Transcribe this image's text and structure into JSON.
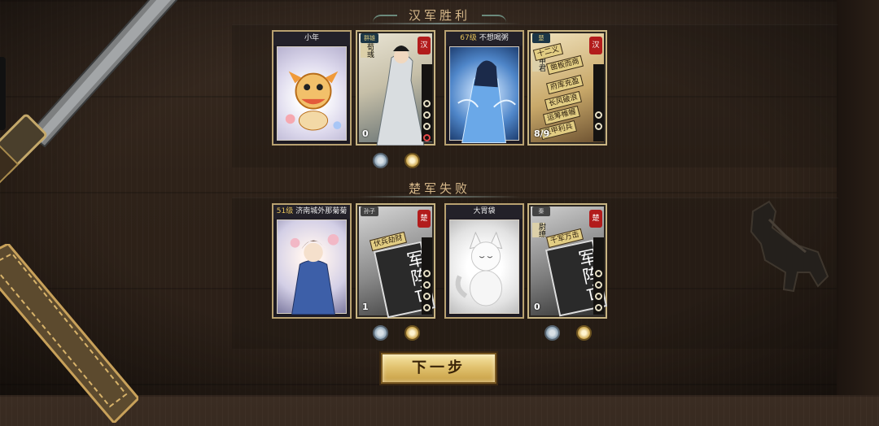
{
  "victory_title": "汉军胜利",
  "defeat_title": "楚军失败",
  "next_button_label": "下一步",
  "winners": [
    {
      "player_name": "小年",
      "level_text": "",
      "pet_art": "lion-dance-pet",
      "general": {
        "faction": "群雄",
        "name": "荀彧",
        "seal": "汉",
        "count": "0",
        "tags": []
      },
      "badges": [
        "blue-badge",
        "gold-badge"
      ]
    },
    {
      "player_name": "不想喝粥",
      "level_text": "67级",
      "pet_art": "blue-robed-lady",
      "general": {
        "faction": "楚",
        "name": "春申君",
        "seal": "汉",
        "count": "8/9",
        "tags": [
          "十二义",
          "凿板而商",
          "府库充盈",
          "长风破浪",
          "运筹帷幄",
          "坚甲利兵"
        ]
      },
      "badges": []
    }
  ],
  "losers": [
    {
      "player_name": "济南城外那菊菊",
      "level_text": "51级",
      "pet_art": "blue-robed-girl",
      "general": {
        "faction": "孙子",
        "name": "",
        "seal": "楚",
        "count": "1",
        "tags": [
          "伏兵劫财"
        ],
        "stamp": "军阵亡"
      },
      "badges": [
        "blue-badge",
        "gold-badge"
      ]
    },
    {
      "player_name": "大胃袋",
      "level_text": "",
      "pet_art": "white-fox-pet",
      "general": {
        "faction": "秦",
        "name": "尉缭",
        "seal": "楚",
        "count": "0",
        "tags": [
          "千军万击"
        ],
        "stamp": "军阵亡"
      },
      "badges": [
        "blue-badge",
        "gold-badge"
      ]
    }
  ],
  "colors": {
    "title_gold": "#d6b88a",
    "card_border": "#b8a170",
    "level_gold": "#e8c35a",
    "button_gold": "#e2c370",
    "seal_red": "#b21c1c"
  }
}
